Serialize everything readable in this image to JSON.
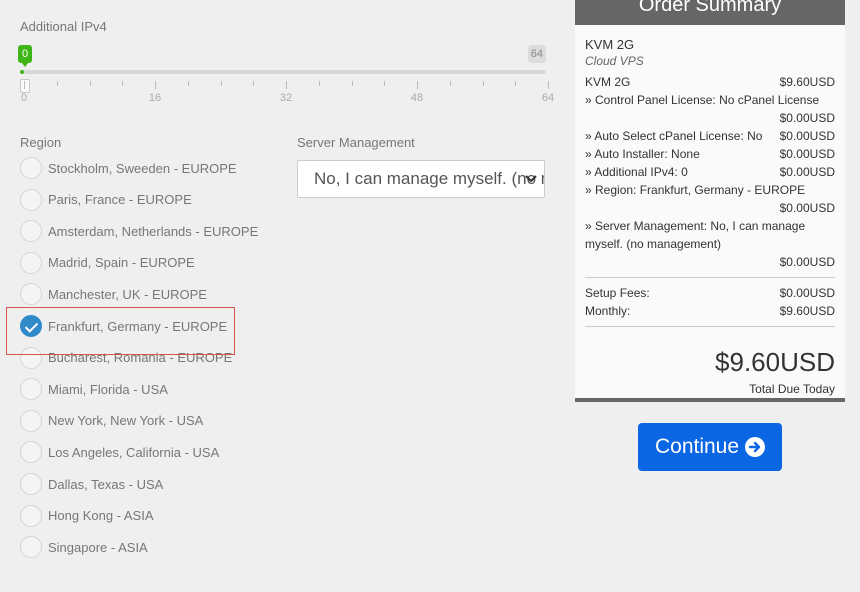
{
  "ipv4": {
    "label": "Additional IPv4",
    "min_value": "0",
    "max_value": "64",
    "current_fraction": 0,
    "ticks": [
      "0",
      "16",
      "32",
      "48",
      "64"
    ]
  },
  "region": {
    "label": "Region",
    "options": [
      "Stockholm, Sweeden - EUROPE",
      "Paris, France - EUROPE",
      "Amsterdam, Netherlands - EUROPE",
      "Madrid, Spain - EUROPE",
      "Manchester, UK - EUROPE",
      "Frankfurt, Germany - EUROPE",
      "Bucharest, Romania - EUROPE",
      "Miami, Florida - USA",
      "New York, New York - USA",
      "Los Angeles, California - USA",
      "Dallas, Texas - USA",
      "Hong Kong - ASIA",
      "Singapore - ASIA"
    ],
    "selected": "Frankfurt, Germany - EUROPE"
  },
  "management": {
    "label": "Server Management",
    "selected_value": "No, I can manage myself. (no management)",
    "icon": "chevron-down-icon"
  },
  "summary": {
    "title": "Order Summary",
    "product_name": "KVM 2G",
    "product_group": "Cloud VPS",
    "base_line": {
      "label": "KVM 2G",
      "price": "$9.60USD"
    },
    "options": [
      {
        "label": "» Control Panel License: No cPanel License",
        "price": "$0.00USD",
        "wrap": true
      },
      {
        "label": "» Auto Select cPanel License: No",
        "price": "$0.00USD",
        "wrap": false
      },
      {
        "label": "» Auto Installer: None",
        "price": "$0.00USD",
        "wrap": false
      },
      {
        "label": "» Additional IPv4: 0",
        "price": "$0.00USD",
        "wrap": false
      },
      {
        "label": "» Region: Frankfurt, Germany - EUROPE",
        "price": "$0.00USD",
        "wrap": true
      },
      {
        "label": "» Server Management: No, I can manage myself. (no management)",
        "price": "$0.00USD",
        "wrap": true
      }
    ],
    "setup_fees": {
      "label": "Setup Fees:",
      "price": "$0.00USD"
    },
    "monthly": {
      "label": "Monthly:",
      "price": "$9.60USD"
    },
    "total": "$9.60USD",
    "total_label": "Total Due Today"
  },
  "continue_button": {
    "label": "Continue",
    "icon": "arrow-circle-right-icon"
  },
  "colors": {
    "slider_active": "#3fb618",
    "radio_checked": "#2f8ac9",
    "button": "#0b66e4",
    "highlight_border": "#d9534f"
  }
}
